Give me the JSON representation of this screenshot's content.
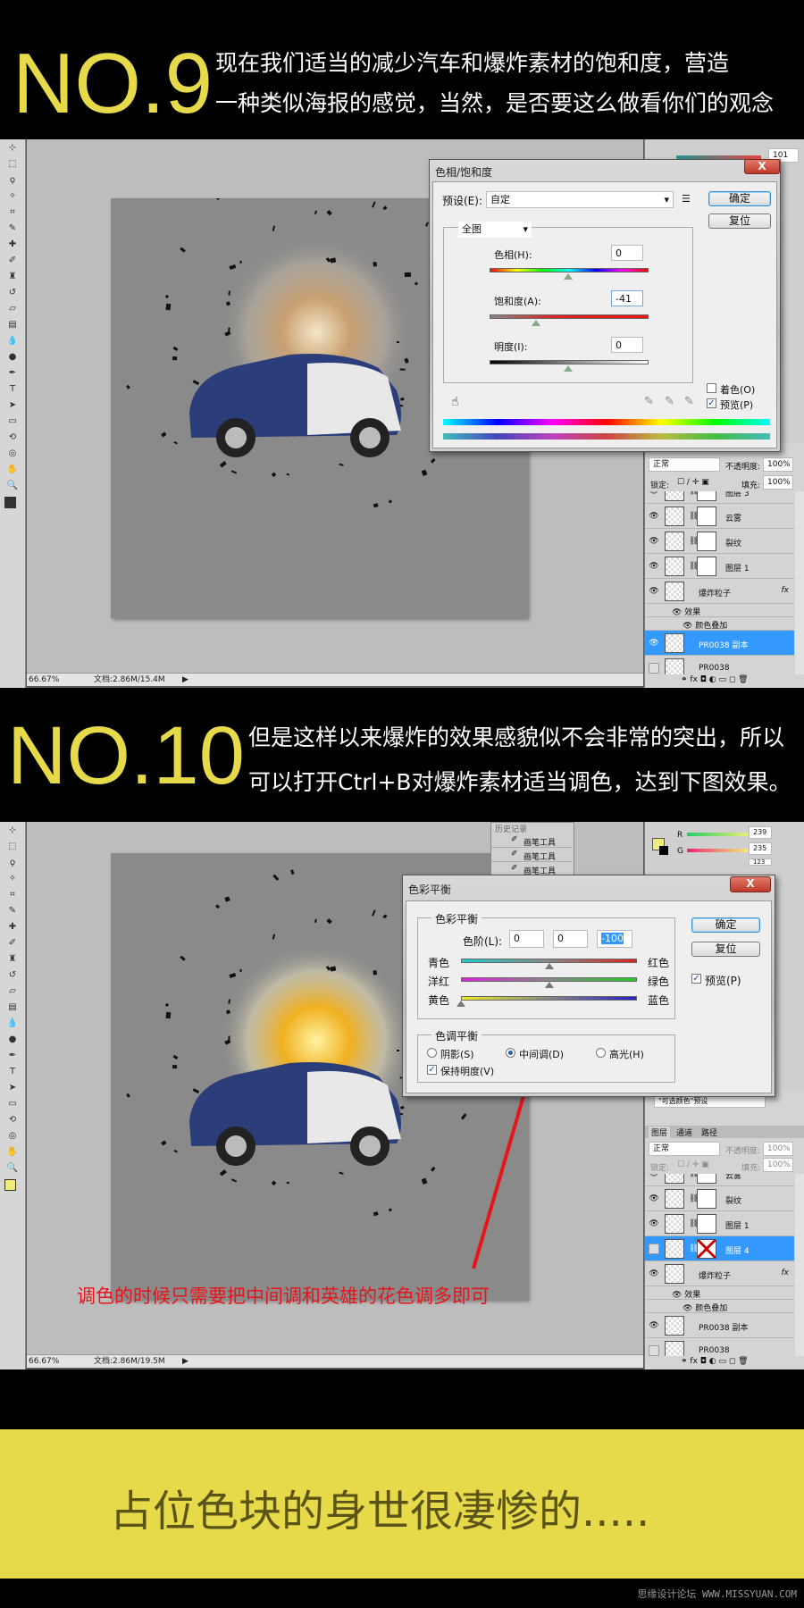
{
  "step9": {
    "number": "NO.9",
    "lines": [
      "现在我们适当的减少汽车和爆炸素材的饱和度，营造",
      "一种类似海报的感觉，当然，是否要这么做看你们的观念"
    ]
  },
  "step10": {
    "number": "NO.10",
    "lines": [
      "但是这样以来爆炸的效果感貌似不会非常的突出，所以",
      "可以打开Ctrl+B对爆炸素材适当调色，达到下图效果。"
    ]
  },
  "ps1": {
    "status": {
      "zoom": "66.67%",
      "doc": "文档:2.86M/15.4M"
    },
    "color_panel": {
      "r_value": "101"
    },
    "hue_sat": {
      "title": "色相/饱和度",
      "close": "X",
      "preset_label": "预设(E):",
      "preset_value": "自定",
      "ok": "确定",
      "reset": "复位",
      "channel": "全图",
      "hue_label": "色相(H):",
      "hue_value": "0",
      "sat_label": "饱和度(A):",
      "sat_value": "-41",
      "light_label": "明度(I):",
      "light_value": "0",
      "colorize_label": "着色(O)",
      "colorize_checked": false,
      "preview_label": "预览(P)",
      "preview_checked": true
    },
    "layers": {
      "blend_mode": "正常",
      "opacity_label": "不透明度:",
      "opacity": "100%",
      "lock_label": "锁定:",
      "fill_label": "填充:",
      "fill": "100%",
      "items": [
        {
          "name": "图层 3",
          "visible": true,
          "mask": true
        },
        {
          "name": "云雾",
          "visible": true,
          "mask": true
        },
        {
          "name": "裂纹",
          "visible": true,
          "mask": true
        },
        {
          "name": "图层 1",
          "visible": true,
          "mask": true
        },
        {
          "name": "爆炸粒子",
          "visible": true,
          "fx": "fx"
        },
        {
          "name": "效果",
          "sub": 1
        },
        {
          "name": "颜色叠加",
          "sub": 2
        },
        {
          "name": "PR0038 副本",
          "visible": true,
          "selected": true
        },
        {
          "name": "PR0038",
          "visible": false
        }
      ]
    }
  },
  "ps2": {
    "status": {
      "zoom": "66.67%",
      "doc": "文档:2.86M/19.5M"
    },
    "history": {
      "title": "历史记录",
      "items": [
        "画笔工具",
        "画笔工具",
        "画笔工具"
      ]
    },
    "color_panel": {
      "r_label": "R",
      "r_value": "239",
      "g_label": "G",
      "g_value": "235",
      "b_value": "123",
      "fg_color": "#efeb7b"
    },
    "adjust_preset": "\"可选颜色\"预设",
    "color_balance": {
      "title": "色彩平衡",
      "close": "X",
      "group1": "色彩平衡",
      "levels_label": "色阶(L):",
      "levels": [
        "0",
        "0",
        "-100"
      ],
      "rows": [
        {
          "left": "青色",
          "right": "红色",
          "value": 0
        },
        {
          "left": "洋红",
          "right": "绿色",
          "value": 0
        },
        {
          "left": "黄色",
          "right": "蓝色",
          "value": -100
        }
      ],
      "group2": "色调平衡",
      "shadows": "阴影(S)",
      "midtones": "中间调(D)",
      "highlights": "高光(H)",
      "selected_tone": "midtones",
      "preserve_label": "保持明度(V)",
      "preserve_checked": true,
      "ok": "确定",
      "reset": "复位",
      "preview_label": "预览(P)",
      "preview_checked": true
    },
    "annotation": "调色的时候只需要把中间调和英雄的花色调多即可",
    "layers": {
      "tabs": [
        "图层",
        "通道",
        "路径"
      ],
      "blend_mode": "正常",
      "opacity_label": "不透明度:",
      "opacity": "100%",
      "lock_label": "锁定:",
      "fill_label": "填充:",
      "fill": "100%",
      "items": [
        {
          "name": "云雾",
          "visible": true,
          "mask": true
        },
        {
          "name": "裂纹",
          "visible": true,
          "mask": true
        },
        {
          "name": "图层 1",
          "visible": true,
          "mask": true
        },
        {
          "name": "图层 4",
          "visible": false,
          "mask": true,
          "selected": true
        },
        {
          "name": "爆炸粒子",
          "visible": true,
          "fx": "fx"
        },
        {
          "name": "效果",
          "sub": 1
        },
        {
          "name": "颜色叠加",
          "sub": 2
        },
        {
          "name": "PR0038 副本",
          "visible": true
        },
        {
          "name": "PR0038",
          "visible": false
        }
      ]
    }
  },
  "banner": {
    "text": "占位色块的身世很凄惨的.....",
    "bg": "#e6d94a",
    "color": "#5b5418"
  },
  "watermark": {
    "text": "思缘设计论坛 WWW.MISSYUAN.COM"
  },
  "colors": {
    "accent_yellow": "#e6d94a",
    "selection_blue": "#3399ff",
    "annotation_red": "#e8141a"
  }
}
